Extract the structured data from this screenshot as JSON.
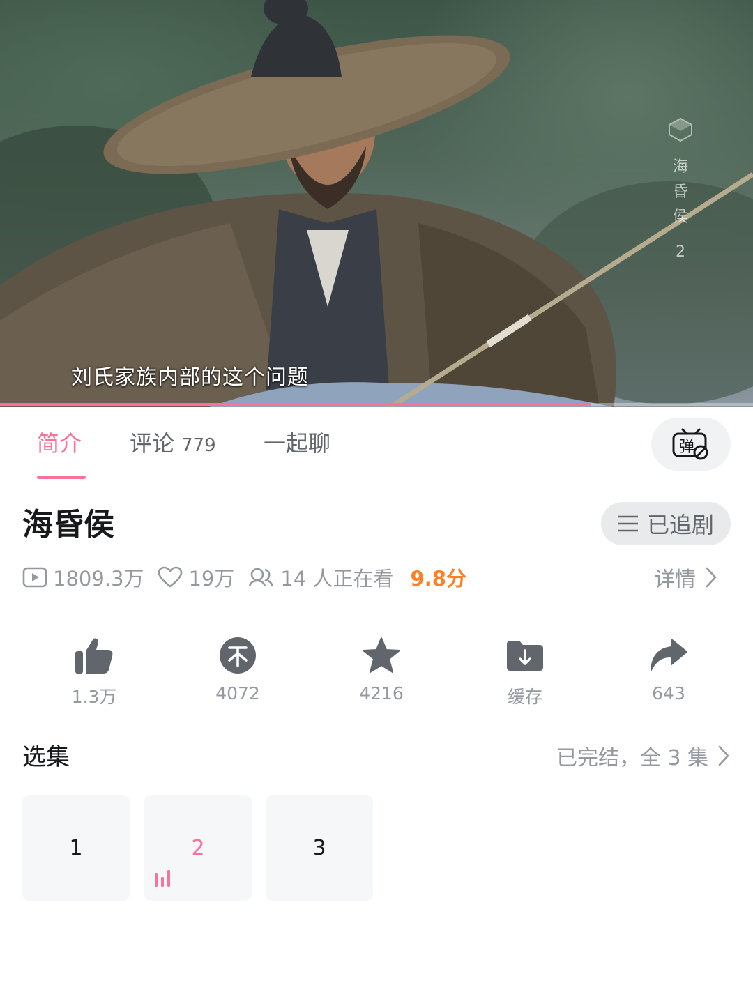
{
  "video": {
    "subtitle": "刘氏家族内部的这个问题",
    "watermark_chars": [
      "海",
      "昏",
      "侯",
      "2"
    ],
    "progress_percent": 78.5
  },
  "tabs": {
    "intro": "简介",
    "comments": "评论",
    "comments_count": "779",
    "chat": "一起聊"
  },
  "danmaku_toggle": {
    "icon": "danmaku-off-icon",
    "char": "弹"
  },
  "show": {
    "title": "海昏侯",
    "follow_label": "已追剧"
  },
  "stats": {
    "views": "1809.3万",
    "likes": "19万",
    "watching": "14 人正在看",
    "score": "9.8分",
    "details": "详情"
  },
  "actions": [
    {
      "icon": "thumbs-up-icon",
      "label": "1.3万"
    },
    {
      "icon": "coin-icon",
      "label": "4072"
    },
    {
      "icon": "star-icon",
      "label": "4216"
    },
    {
      "icon": "download-folder-icon",
      "label": "缓存"
    },
    {
      "icon": "share-icon",
      "label": "643"
    }
  ],
  "episodes": {
    "title": "选集",
    "status": "已完结，全 3 集",
    "items": [
      {
        "label": "1",
        "playing": false
      },
      {
        "label": "2",
        "playing": true
      },
      {
        "label": "3",
        "playing": false
      }
    ]
  },
  "colors": {
    "accent": "#fb7299",
    "score": "#ff7f24",
    "muted": "#9499a0"
  }
}
